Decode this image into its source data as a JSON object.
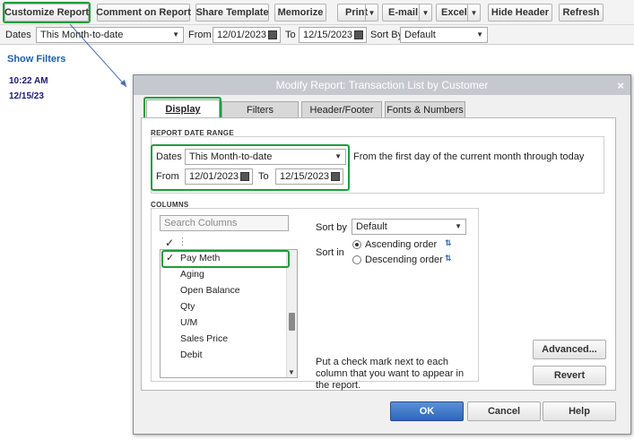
{
  "toolbar": {
    "customize_report": "Customize Report",
    "comment_on_report": "Comment on Report",
    "share_template": "Share Template",
    "memorize": "Memorize",
    "print": "Print",
    "email": "E-mail",
    "excel": "Excel",
    "hide_header": "Hide Header",
    "refresh": "Refresh"
  },
  "filterbar": {
    "dates_label": "Dates",
    "dates_value": "This Month-to-date",
    "from_label": "From",
    "from_value": "12/01/2023",
    "to_label": "To",
    "to_value": "12/15/2023",
    "sortby_label": "Sort By",
    "sortby_value": "Default"
  },
  "report": {
    "show_filters": "Show Filters",
    "time": "10:22 AM",
    "date": "12/15/23"
  },
  "dialog": {
    "title": "Modify Report: Transaction List by Customer",
    "close_glyph": "×",
    "tabs": [
      "Display",
      "Filters",
      "Header/Footer",
      "Fonts & Numbers"
    ],
    "date_range": {
      "title": "REPORT DATE RANGE",
      "dates_label": "Dates",
      "dates_value": "This Month-to-date",
      "description": "From the first day of the current month through today",
      "from_label": "From",
      "from_value": "12/01/2023",
      "to_label": "To",
      "to_value": "12/15/2023"
    },
    "columns": {
      "title": "COLUMNS",
      "search_placeholder": "Search Columns",
      "header_check": "✓",
      "items": [
        {
          "label": "Pay Meth",
          "check": "✓"
        },
        {
          "label": "Aging",
          "check": ""
        },
        {
          "label": "Open Balance",
          "check": ""
        },
        {
          "label": "Qty",
          "check": ""
        },
        {
          "label": "U/M",
          "check": ""
        },
        {
          "label": "Sales Price",
          "check": ""
        },
        {
          "label": "Debit",
          "check": ""
        }
      ],
      "sort_by_label": "Sort by",
      "sort_by_value": "Default",
      "sort_in_label": "Sort in",
      "ascending": "Ascending order",
      "descending": "Descending order",
      "hint": "Put a check mark next to each column that you want to appear in the report."
    },
    "buttons": {
      "advanced": "Advanced...",
      "revert": "Revert",
      "ok": "OK",
      "cancel": "Cancel",
      "help": "Help"
    }
  },
  "colors": {
    "highlight": "#1a9e3c",
    "ok_button": "#2f66b8",
    "link": "#1f5fa8"
  }
}
